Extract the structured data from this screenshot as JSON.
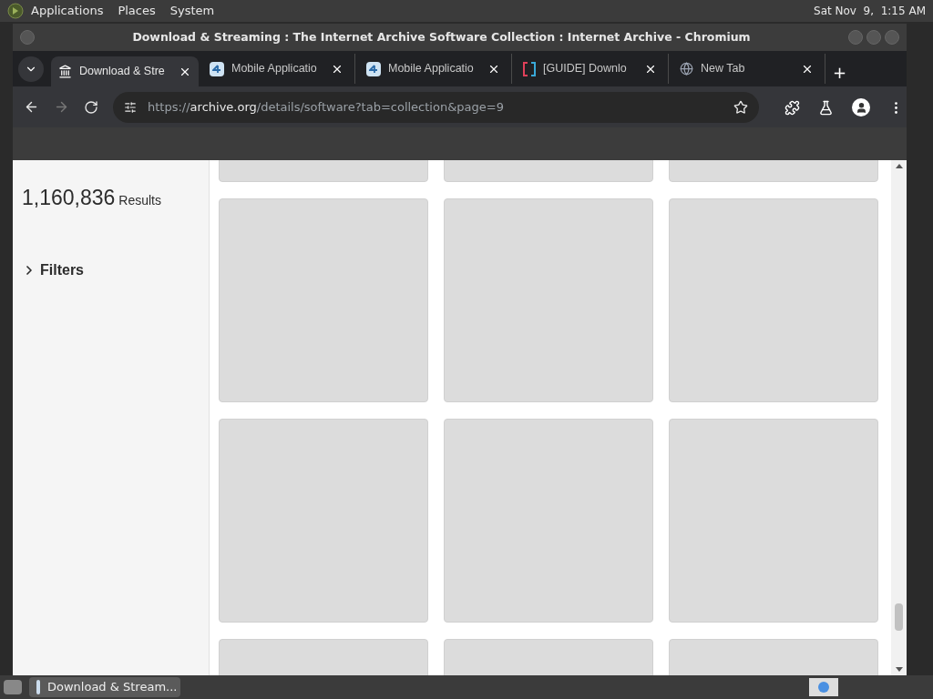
{
  "top_panel": {
    "menus": [
      "Applications",
      "Places",
      "System"
    ],
    "clock": "Sat Nov  9,  1:15 AM"
  },
  "window": {
    "title": "Download & Streaming : The Internet Archive Software Collection : Internet Archive - Chromium"
  },
  "tabs": [
    {
      "label": "Download & Stre",
      "kind": "archive",
      "selected": true
    },
    {
      "label": "Mobile Applicatio",
      "kind": "four",
      "selected": false
    },
    {
      "label": "Mobile Applicatio",
      "kind": "four",
      "selected": false
    },
    {
      "label": "[GUIDE] Downlo",
      "kind": "bracket",
      "selected": false
    },
    {
      "label": "New Tab",
      "kind": "globe",
      "selected": false
    }
  ],
  "new_tab": "+",
  "address_bar": {
    "scheme": "https://",
    "host": "archive.org",
    "path": "/details/software?tab=collection&page=9"
  },
  "sidebar": {
    "count": "1,160,836",
    "count_label": "Results",
    "filters": "Filters",
    "filters_expanded": false
  },
  "grid": {
    "tiles": [
      {
        "kind": "placeholder"
      },
      {
        "kind": "placeholder"
      },
      {
        "kind": "placeholder"
      },
      {
        "kind": "placeholder"
      },
      {
        "kind": "placeholder"
      },
      {
        "kind": "placeholder"
      },
      {
        "kind": "placeholder"
      },
      {
        "kind": "placeholder"
      },
      {
        "kind": "placeholder"
      },
      {
        "kind": "placeholder"
      },
      {
        "kind": "placeholder"
      },
      {
        "kind": "placeholder"
      }
    ]
  },
  "taskbar": {
    "tasks": [
      {
        "label": "Download & Stream...",
        "selected": true
      }
    ]
  }
}
